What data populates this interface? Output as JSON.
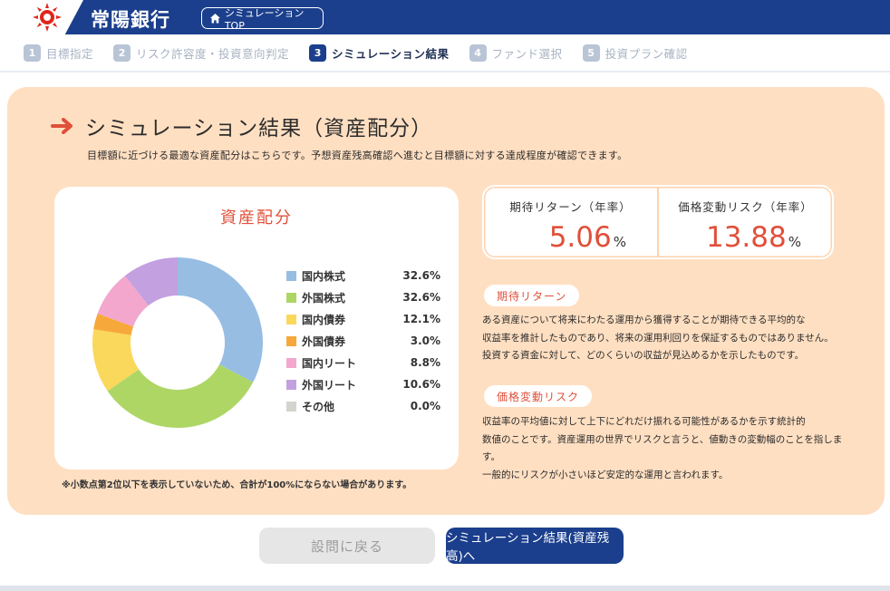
{
  "header": {
    "bank_name": "常陽銀行",
    "top_button": "シミュレーションTOP",
    "home_icon": "home-icon",
    "brand_color": "#1b3f8d"
  },
  "steps": [
    {
      "num": "1",
      "label": "目標指定",
      "active": false
    },
    {
      "num": "2",
      "label": "リスク許容度・投資意向判定",
      "active": false
    },
    {
      "num": "3",
      "label": "シミュレーション結果",
      "active": true
    },
    {
      "num": "4",
      "label": "ファンド選択",
      "active": false
    },
    {
      "num": "5",
      "label": "投資プラン確認",
      "active": false
    }
  ],
  "main": {
    "title": "シミュレーション結果（資産配分）",
    "subtitle": "目標額に近づける最適な資産配分はこちらです。予想資産残高確認へ進むと目標額に対する達成程度が確認できます。",
    "note": "※小数点第2位以下を表示していないため、合計が100%にならない場合があります。"
  },
  "chart_data": {
    "type": "pie",
    "title": "資産配分",
    "categories": [
      "国内株式",
      "外国株式",
      "国内債券",
      "外国債券",
      "国内リート",
      "外国リート",
      "その他"
    ],
    "values": [
      32.6,
      32.6,
      12.1,
      3.0,
      8.8,
      10.6,
      0.0
    ],
    "value_labels": [
      "32.6%",
      "32.6%",
      "12.1%",
      "3.0%",
      "8.8%",
      "10.6%",
      "0.0%"
    ],
    "colors": [
      "#97bde3",
      "#aed665",
      "#fad85c",
      "#f7a83a",
      "#f3a7cd",
      "#c3a0e0",
      "#d4d4ce"
    ],
    "legend": "right"
  },
  "stats": {
    "return_label": "期待リターン（年率）",
    "return_value": "5.06",
    "return_unit": "%",
    "risk_label": "価格変動リスク（年率）",
    "risk_value": "13.88",
    "risk_unit": "%"
  },
  "explanations": {
    "return_title": "期待リターン",
    "return_lines": [
      "ある資産について将来にわたる運用から獲得することが期待できる平均的な",
      "収益率を推計したものであり、将来の運用利回りを保証するものではありません。",
      "投資する資金に対して、どのくらいの収益が見込めるかを示したものです。"
    ],
    "risk_title": "価格変動リスク",
    "risk_lines": [
      "収益率の平均値に対して上下にどれだけ振れる可能性があるかを示す統計的",
      "数値のことです。資産運用の世界でリスクと言うと、値動きの変動幅のことを指します。",
      "一般的にリスクが小さいほど安定的な運用と言われます。"
    ]
  },
  "buttons": {
    "back": "設問に戻る",
    "next": "シミュレーション結果(資産残高)へ"
  },
  "accent_color": "#e0503a",
  "panel_color": "#ffdfc2"
}
